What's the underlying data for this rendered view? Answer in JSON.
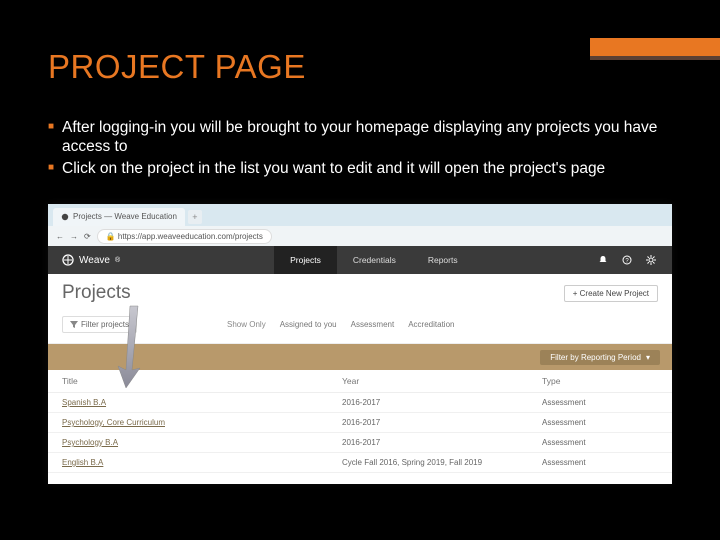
{
  "slide": {
    "title": "PROJECT PAGE",
    "bullets": [
      "After logging-in you will be brought to your homepage displaying any projects you have access to",
      "Click on the project in the list you want to edit and it will open the project's page"
    ]
  },
  "browser": {
    "tab_title": "Projects — Weave Education",
    "url": "https://app.weaveeducation.com/projects"
  },
  "app": {
    "brand": "Weave",
    "nav": [
      "Projects",
      "Credentials",
      "Reports"
    ],
    "active_nav": "Projects",
    "page_title": "Projects",
    "create_btn": "+ Create New Project",
    "filter_btn": "Filter projects",
    "show_only": "Show Only",
    "chips": [
      "Assigned to you",
      "Assessment",
      "Accreditation"
    ],
    "period_btn": "Filter by Reporting Period",
    "columns": [
      "Title",
      "Year",
      "Type"
    ],
    "rows": [
      {
        "title": "Spanish B.A",
        "year": "2016-2017",
        "type": "Assessment"
      },
      {
        "title": "Psychology, Core Curriculum",
        "year": "2016-2017",
        "type": "Assessment"
      },
      {
        "title": "Psychology B.A",
        "year": "2016-2017",
        "type": "Assessment"
      },
      {
        "title": "English B.A",
        "year": "Cycle Fall 2016, Spring 2019, Fall 2019",
        "type": "Assessment"
      }
    ]
  }
}
